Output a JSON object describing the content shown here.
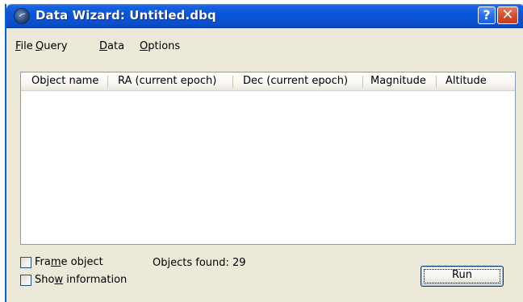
{
  "window": {
    "title": "Data Wizard: Untitled.dbq",
    "help_button_label": "?",
    "close_button_label": "✕"
  },
  "menubar": {
    "items": [
      {
        "label_first": "F",
        "label_rest": "ile"
      },
      {
        "label_first": "Q",
        "label_rest": "uery"
      },
      {
        "label_first": "D",
        "label_rest": "ata"
      },
      {
        "label_first": "O",
        "label_rest": "ptions"
      }
    ]
  },
  "results_table": {
    "columns": [
      "Object name",
      "RA (current epoch)",
      "Dec (current epoch)",
      "Magnitude",
      "Altitude"
    ],
    "rows": []
  },
  "options": {
    "frame_object": {
      "label_before": "Fra",
      "label_ul": "m",
      "label_after": "e object",
      "checked": false
    },
    "show_information": {
      "label_before": "Sho",
      "label_ul": "w",
      "label_after": " information",
      "checked": false
    }
  },
  "status": {
    "objects_found_text": "Objects found: 29"
  },
  "run_button": {
    "label": "Run"
  },
  "colors": {
    "titlebar": "#0a55d8",
    "window_bg": "#ece9d8",
    "close_button": "#c43d1c"
  },
  "icons": {
    "app": "data-wizard-app-icon",
    "help": "help-icon",
    "close": "close-icon"
  }
}
